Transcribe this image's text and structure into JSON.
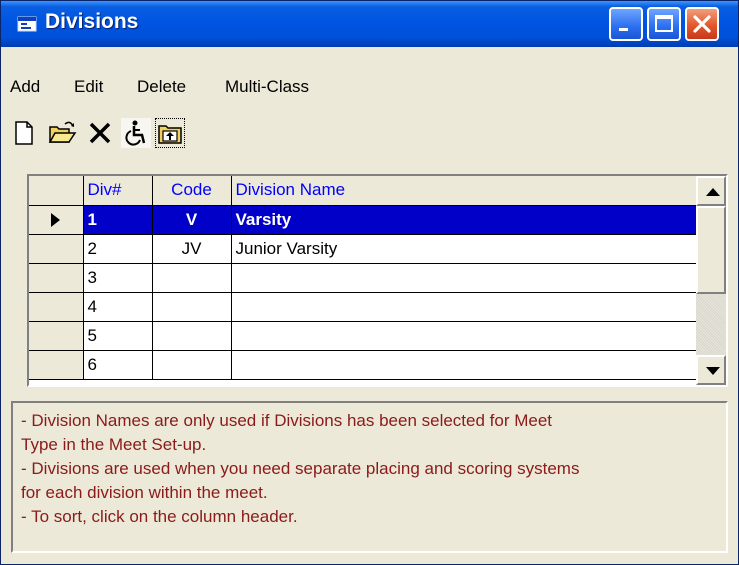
{
  "window": {
    "title": "Divisions",
    "title_icon": "window-app-icon",
    "controls": [
      "minimize-icon",
      "maximize-icon",
      "close-icon"
    ]
  },
  "menu": [
    "Add",
    "Edit",
    "Delete",
    "Multi-Class"
  ],
  "toolbar": {
    "tools": [
      "new-document-icon",
      "open-folder-icon",
      "delete-x-icon",
      "accessibility-icon",
      "move-up-folder-icon"
    ]
  },
  "grid": {
    "headers": {
      "div": "Div#",
      "code": "Code",
      "name": "Division Name"
    },
    "rows": [
      {
        "div": "1",
        "code": "V",
        "name": "Varsity"
      },
      {
        "div": "2",
        "code": "JV",
        "name": "Junior Varsity"
      },
      {
        "div": "3",
        "code": "",
        "name": ""
      },
      {
        "div": "4",
        "code": "",
        "name": ""
      },
      {
        "div": "5",
        "code": "",
        "name": ""
      },
      {
        "div": "6",
        "code": "",
        "name": ""
      }
    ],
    "selected_row": 0
  },
  "hint": {
    "lines": [
      "- Division Names are only used if Divisions has been selected for Meet",
      "Type in the Meet Set-up.",
      "- Divisions are used when you need separate placing and scoring systems",
      "for each division within the meet.",
      "- To sort, click on the column header."
    ]
  },
  "colors": {
    "title_bar": "#0054e3",
    "header_text": "#0000ff",
    "selection": "#0000c8",
    "hint_text": "#8b1a1a"
  }
}
